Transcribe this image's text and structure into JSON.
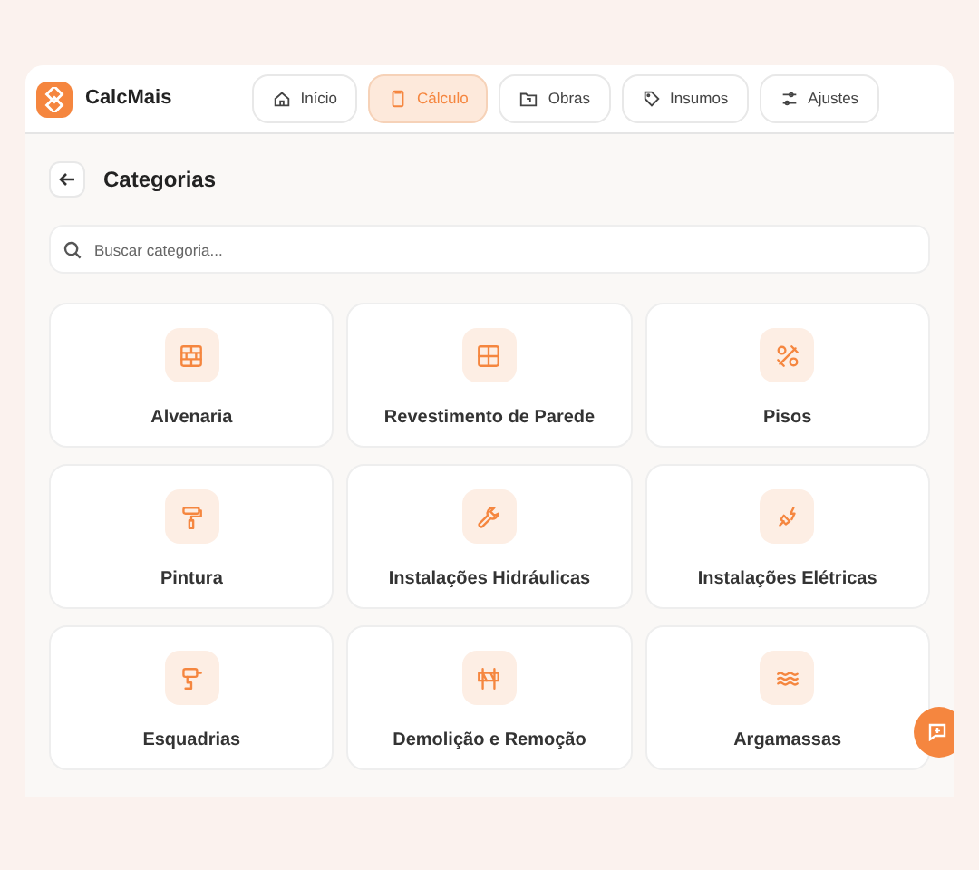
{
  "app": {
    "name": "CalcMais"
  },
  "nav": [
    {
      "label": "Início",
      "selected": false
    },
    {
      "label": "Cálculo",
      "selected": true
    },
    {
      "label": "Obras",
      "selected": false
    },
    {
      "label": "Insumos",
      "selected": false
    },
    {
      "label": "Ajustes",
      "selected": false
    }
  ],
  "page": {
    "title": "Categorias"
  },
  "search": {
    "placeholder": "Buscar categoria..."
  },
  "categories": [
    {
      "label": "Alvenaria"
    },
    {
      "label": "Revestimento de Parede"
    },
    {
      "label": "Pisos"
    },
    {
      "label": "Pintura"
    },
    {
      "label": "Instalações Hidráulicas"
    },
    {
      "label": "Instalações Elétricas"
    },
    {
      "label": "Esquadrias"
    },
    {
      "label": "Demolição e Remoção"
    },
    {
      "label": "Argamassas"
    }
  ]
}
